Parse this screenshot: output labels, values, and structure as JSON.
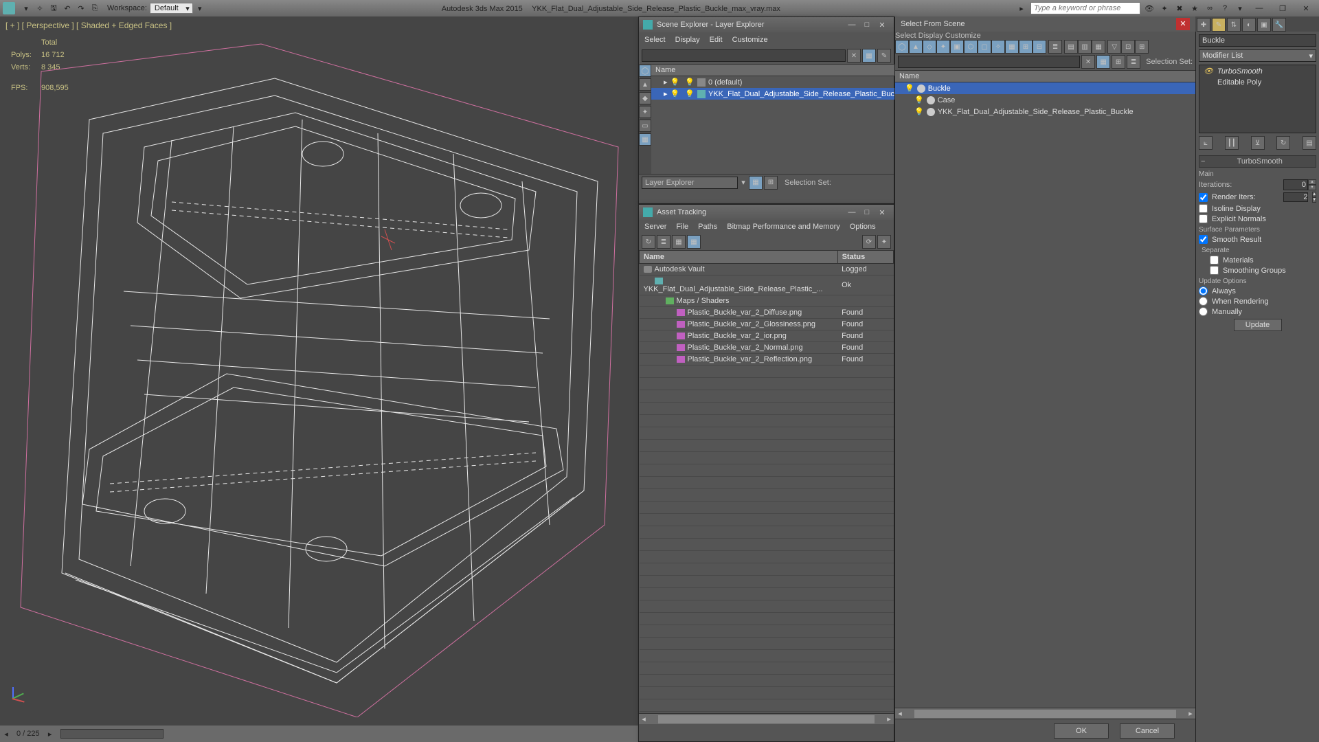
{
  "titlebar": {
    "workspace_label": "Workspace:",
    "workspace_value": "Default",
    "app": "Autodesk 3ds Max 2015",
    "file": "YKK_Flat_Dual_Adjustable_Side_Release_Plastic_Buckle_max_vray.max",
    "search_placeholder": "Type a keyword or phrase"
  },
  "viewport": {
    "label": "[ + ] [ Perspective ] [ Shaded + Edged Faces ]",
    "stats": {
      "total": "Total",
      "polys_label": "Polys:",
      "polys": "16 712",
      "verts_label": "Verts:",
      "verts": "8 345",
      "fps_label": "FPS:",
      "fps": "908,595"
    }
  },
  "statusbar": {
    "frame": "0 / 225"
  },
  "scene_explorer": {
    "title": "Scene Explorer - Layer Explorer",
    "menus": [
      "Select",
      "Display",
      "Edit",
      "Customize"
    ],
    "col_name": "Name",
    "items": [
      {
        "label": "0 (default)",
        "indent": 1,
        "sel": false
      },
      {
        "label": "YKK_Flat_Dual_Adjustable_Side_Release_Plastic_Buckle",
        "indent": 1,
        "sel": true
      }
    ],
    "footer": "Layer Explorer",
    "selset": "Selection Set:"
  },
  "asset": {
    "title": "Asset Tracking",
    "menus": [
      "Server",
      "File",
      "Paths",
      "Bitmap Performance and Memory",
      "Options"
    ],
    "cols": [
      "Name",
      "Status"
    ],
    "rows": [
      {
        "icon": "vault",
        "indent": 0,
        "name": "Autodesk Vault",
        "status": "Logged"
      },
      {
        "icon": "max",
        "indent": 1,
        "name": "YKK_Flat_Dual_Adjustable_Side_Release_Plastic_...",
        "status": "Ok"
      },
      {
        "icon": "map",
        "indent": 2,
        "name": "Maps / Shaders",
        "status": ""
      },
      {
        "icon": "png",
        "indent": 3,
        "name": "Plastic_Buckle_var_2_Diffuse.png",
        "status": "Found"
      },
      {
        "icon": "png",
        "indent": 3,
        "name": "Plastic_Buckle_var_2_Glossiness.png",
        "status": "Found"
      },
      {
        "icon": "png",
        "indent": 3,
        "name": "Plastic_Buckle_var_2_ior.png",
        "status": "Found"
      },
      {
        "icon": "png",
        "indent": 3,
        "name": "Plastic_Buckle_var_2_Normal.png",
        "status": "Found"
      },
      {
        "icon": "png",
        "indent": 3,
        "name": "Plastic_Buckle_var_2_Reflection.png",
        "status": "Found"
      }
    ]
  },
  "sfs": {
    "title": "Select From Scene",
    "menus": [
      "Select",
      "Display",
      "Customize"
    ],
    "selset": "Selection Set:",
    "col_name": "Name",
    "items": [
      {
        "label": "Buckle",
        "indent": 0,
        "sel": true
      },
      {
        "label": "Case",
        "indent": 1,
        "sel": false
      },
      {
        "label": "YKK_Flat_Dual_Adjustable_Side_Release_Plastic_Buckle",
        "indent": 1,
        "sel": false
      }
    ],
    "ok": "OK",
    "cancel": "Cancel"
  },
  "mod": {
    "object_name": "Buckle",
    "list_label": "Modifier List",
    "stack": [
      "TurboSmooth",
      "Editable Poly"
    ],
    "rollup": "TurboSmooth",
    "main": "Main",
    "iter_label": "Iterations:",
    "iter": "0",
    "riter_label": "Render Iters:",
    "riter": "2",
    "isoline": "Isoline Display",
    "explicit": "Explicit Normals",
    "surf": "Surface Parameters",
    "smooth_result": "Smooth Result",
    "separate": "Separate",
    "materials": "Materials",
    "smgroups": "Smoothing Groups",
    "updopt": "Update Options",
    "always": "Always",
    "whenr": "When Rendering",
    "manual": "Manually",
    "update": "Update"
  }
}
